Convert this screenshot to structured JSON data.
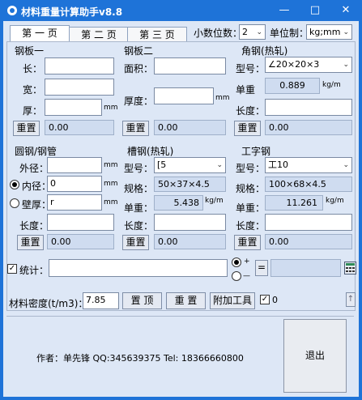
{
  "window": {
    "title": "材料重量计算助手v8.8",
    "minimize": "—",
    "maximize": "□",
    "close": "✕"
  },
  "tabs": [
    "第 一 页",
    "第 二 页",
    "第 三 页"
  ],
  "settings": {
    "decimals_label": "小数位数：",
    "decimals_value": "2",
    "unit_label": "单位制：",
    "unit_value": "kg;mm"
  },
  "plate1": {
    "header": "钢板一",
    "length_label": "长：",
    "width_label": "宽：",
    "thick_label": "厚：",
    "thick_unit": "mm",
    "reset": "重置",
    "result": "0.00"
  },
  "plate2": {
    "header": "钢板二",
    "area_label": "面积：",
    "thick_label": "厚度：",
    "thick_unit": "mm",
    "reset": "重置",
    "result": "0.00"
  },
  "angle": {
    "header": "角钢(热轧)",
    "model_label": "型号：",
    "model_value": "∠20×20×3",
    "unitw_label": "单重",
    "unitw_value": "0.889",
    "unitw_unit": "kg/m",
    "length_label": "长度：",
    "reset": "重置",
    "result": "0.00"
  },
  "round": {
    "header": "圆钢/钢管",
    "outer_label": "外径：",
    "outer_unit": "mm",
    "inner_label": "内径：",
    "inner_value": "0",
    "inner_unit": "mm",
    "wall_label": "壁厚：",
    "wall_value": "r",
    "wall_unit": "mm",
    "length_label": "长度：",
    "reset": "重置",
    "result": "0.00"
  },
  "channel": {
    "header": "槽钢(热轧)",
    "model_label": "型号：",
    "model_value": "[5",
    "spec_label": "规格：",
    "spec_value": "50×37×4.5",
    "unitw_label": "单重：",
    "unitw_value": "5.438",
    "unitw_unit": "kg/m",
    "length_label": "长度：",
    "reset": "重置",
    "result": "0.00"
  },
  "ibeam": {
    "header": "工字钢",
    "model_label": "型号：",
    "model_value": "工10",
    "spec_label": "规格：",
    "spec_value": "100×68×4.5",
    "unitw_label": "单重：",
    "unitw_value": "11.261",
    "unitw_unit": "kg/m",
    "length_label": "长度：",
    "reset": "重置",
    "result": "0.00"
  },
  "stats": {
    "label": "统计：",
    "plus": "+",
    "minus": "—",
    "equals": "="
  },
  "density": {
    "label": "材料密度(t/m3)：",
    "value": "7.85",
    "top_button": "置 顶",
    "reset_button": "重 置",
    "tools_button": "附加工具",
    "check_label": "0",
    "up": "↑"
  },
  "footer": {
    "author": "作者：单先锋 QQ:345639375  Tel: 18366660800",
    "exit": "退出"
  },
  "colors": {
    "titlebar": "#1e73d8",
    "panel": "#dde7f6",
    "readonly": "#cfdcf0"
  }
}
